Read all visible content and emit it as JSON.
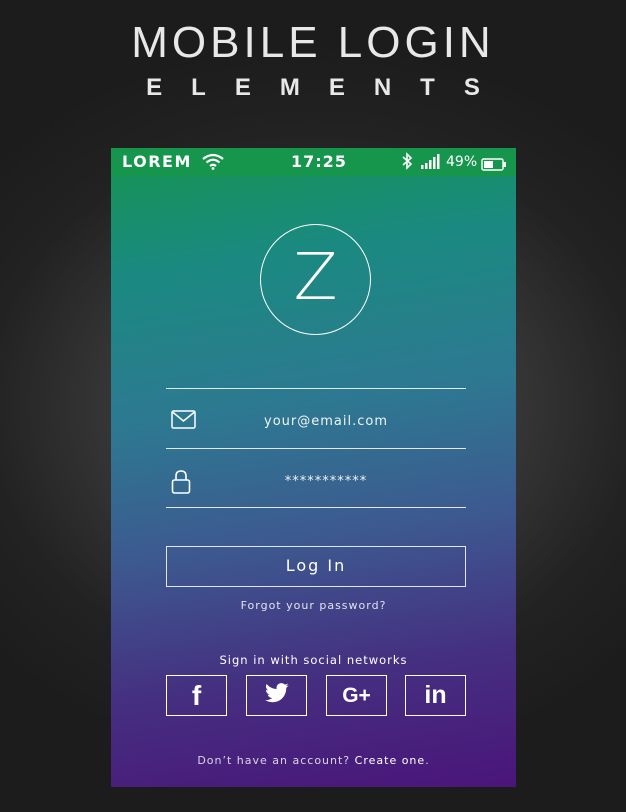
{
  "header": {
    "title": "MOBILE LOGIN",
    "subtitle": "ELEMENTS"
  },
  "status_bar": {
    "carrier": "LOREM",
    "time": "17:25",
    "battery": "49%"
  },
  "logo": {
    "letter": "Z"
  },
  "form": {
    "email_placeholder": "your@email.com",
    "password_value": "***********",
    "login_label": "Log In",
    "forgot_label": "Forgot your password?"
  },
  "social": {
    "caption": "Sign in with social networks",
    "buttons": [
      {
        "label": "f",
        "icon": "facebook-icon"
      },
      {
        "label": "twitter",
        "icon": "twitter-icon"
      },
      {
        "label": "G+",
        "icon": "google-plus-icon"
      },
      {
        "label": "in",
        "icon": "linkedin-icon"
      }
    ]
  },
  "footer": {
    "prompt": "Don’t have an account?",
    "link": "Create one",
    "end": "."
  },
  "colors": {
    "status_bar": "#16964c",
    "gradient_top": "#16944f",
    "gradient_bottom": "#4a157a"
  }
}
